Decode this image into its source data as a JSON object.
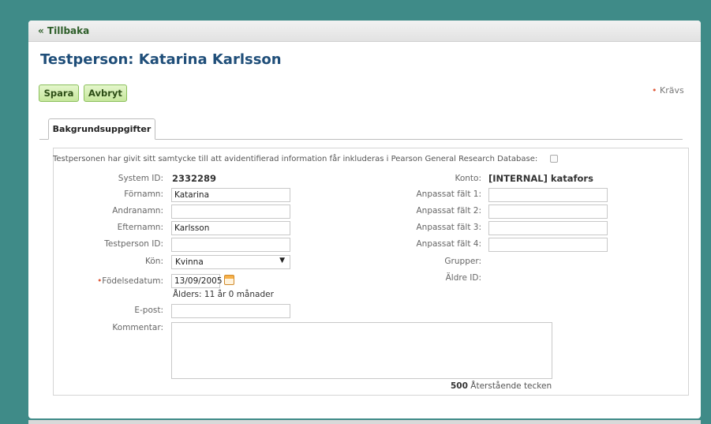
{
  "nav": {
    "back_label": "« Tillbaka"
  },
  "page": {
    "title": "Testperson: Katarina Karlsson"
  },
  "actions": {
    "save_label": "Spara",
    "cancel_label": "Avbryt",
    "required_legend": "Krävs",
    "required_marker": "•"
  },
  "tabs": [
    {
      "label": "Bakgrundsuppgifter",
      "active": true
    }
  ],
  "consent": {
    "text": "Testpersonen har givit sitt samtycke till att avidentifierad information får inkluderas i Pearson General Research Database:",
    "checked": false
  },
  "form": {
    "system_id": {
      "label": "System ID:",
      "value": "2332289"
    },
    "first_name": {
      "label": "Förnamn:",
      "value": "Katarina"
    },
    "middle_name": {
      "label": "Andranamn:",
      "value": ""
    },
    "last_name": {
      "label": "Efternamn:",
      "value": "Karlsson"
    },
    "testperson_id": {
      "label": "Testperson ID:",
      "value": ""
    },
    "gender": {
      "label": "Kön:",
      "value": "Kvinna"
    },
    "birth_date": {
      "label": "Födelsedatum:",
      "value": "13/09/2005",
      "age_text": "Ålders: 11 år 0 månader"
    },
    "email": {
      "label": "E-post:",
      "value": ""
    },
    "comment": {
      "label": "Kommentar:",
      "value": "",
      "remaining_count": "500",
      "remaining_text": "Återstående tecken"
    },
    "account": {
      "label": "Konto:",
      "value": "[INTERNAL] katafors"
    },
    "custom_1": {
      "label": "Anpassat fält 1:",
      "value": ""
    },
    "custom_2": {
      "label": "Anpassat fält 2:",
      "value": ""
    },
    "custom_3": {
      "label": "Anpassat fält 3:",
      "value": ""
    },
    "custom_4": {
      "label": "Anpassat fält 4:",
      "value": ""
    },
    "groups": {
      "label": "Grupper:",
      "value": ""
    },
    "older_id": {
      "label": "Äldre ID:",
      "value": ""
    }
  },
  "icons": {
    "calendar": "calendar-icon",
    "dropdown": "chevron-down-icon"
  },
  "colors": {
    "background": "#3f8b88",
    "title": "#1f4e79",
    "button_bg": "#c7e79d",
    "required": "#e05a3a"
  }
}
